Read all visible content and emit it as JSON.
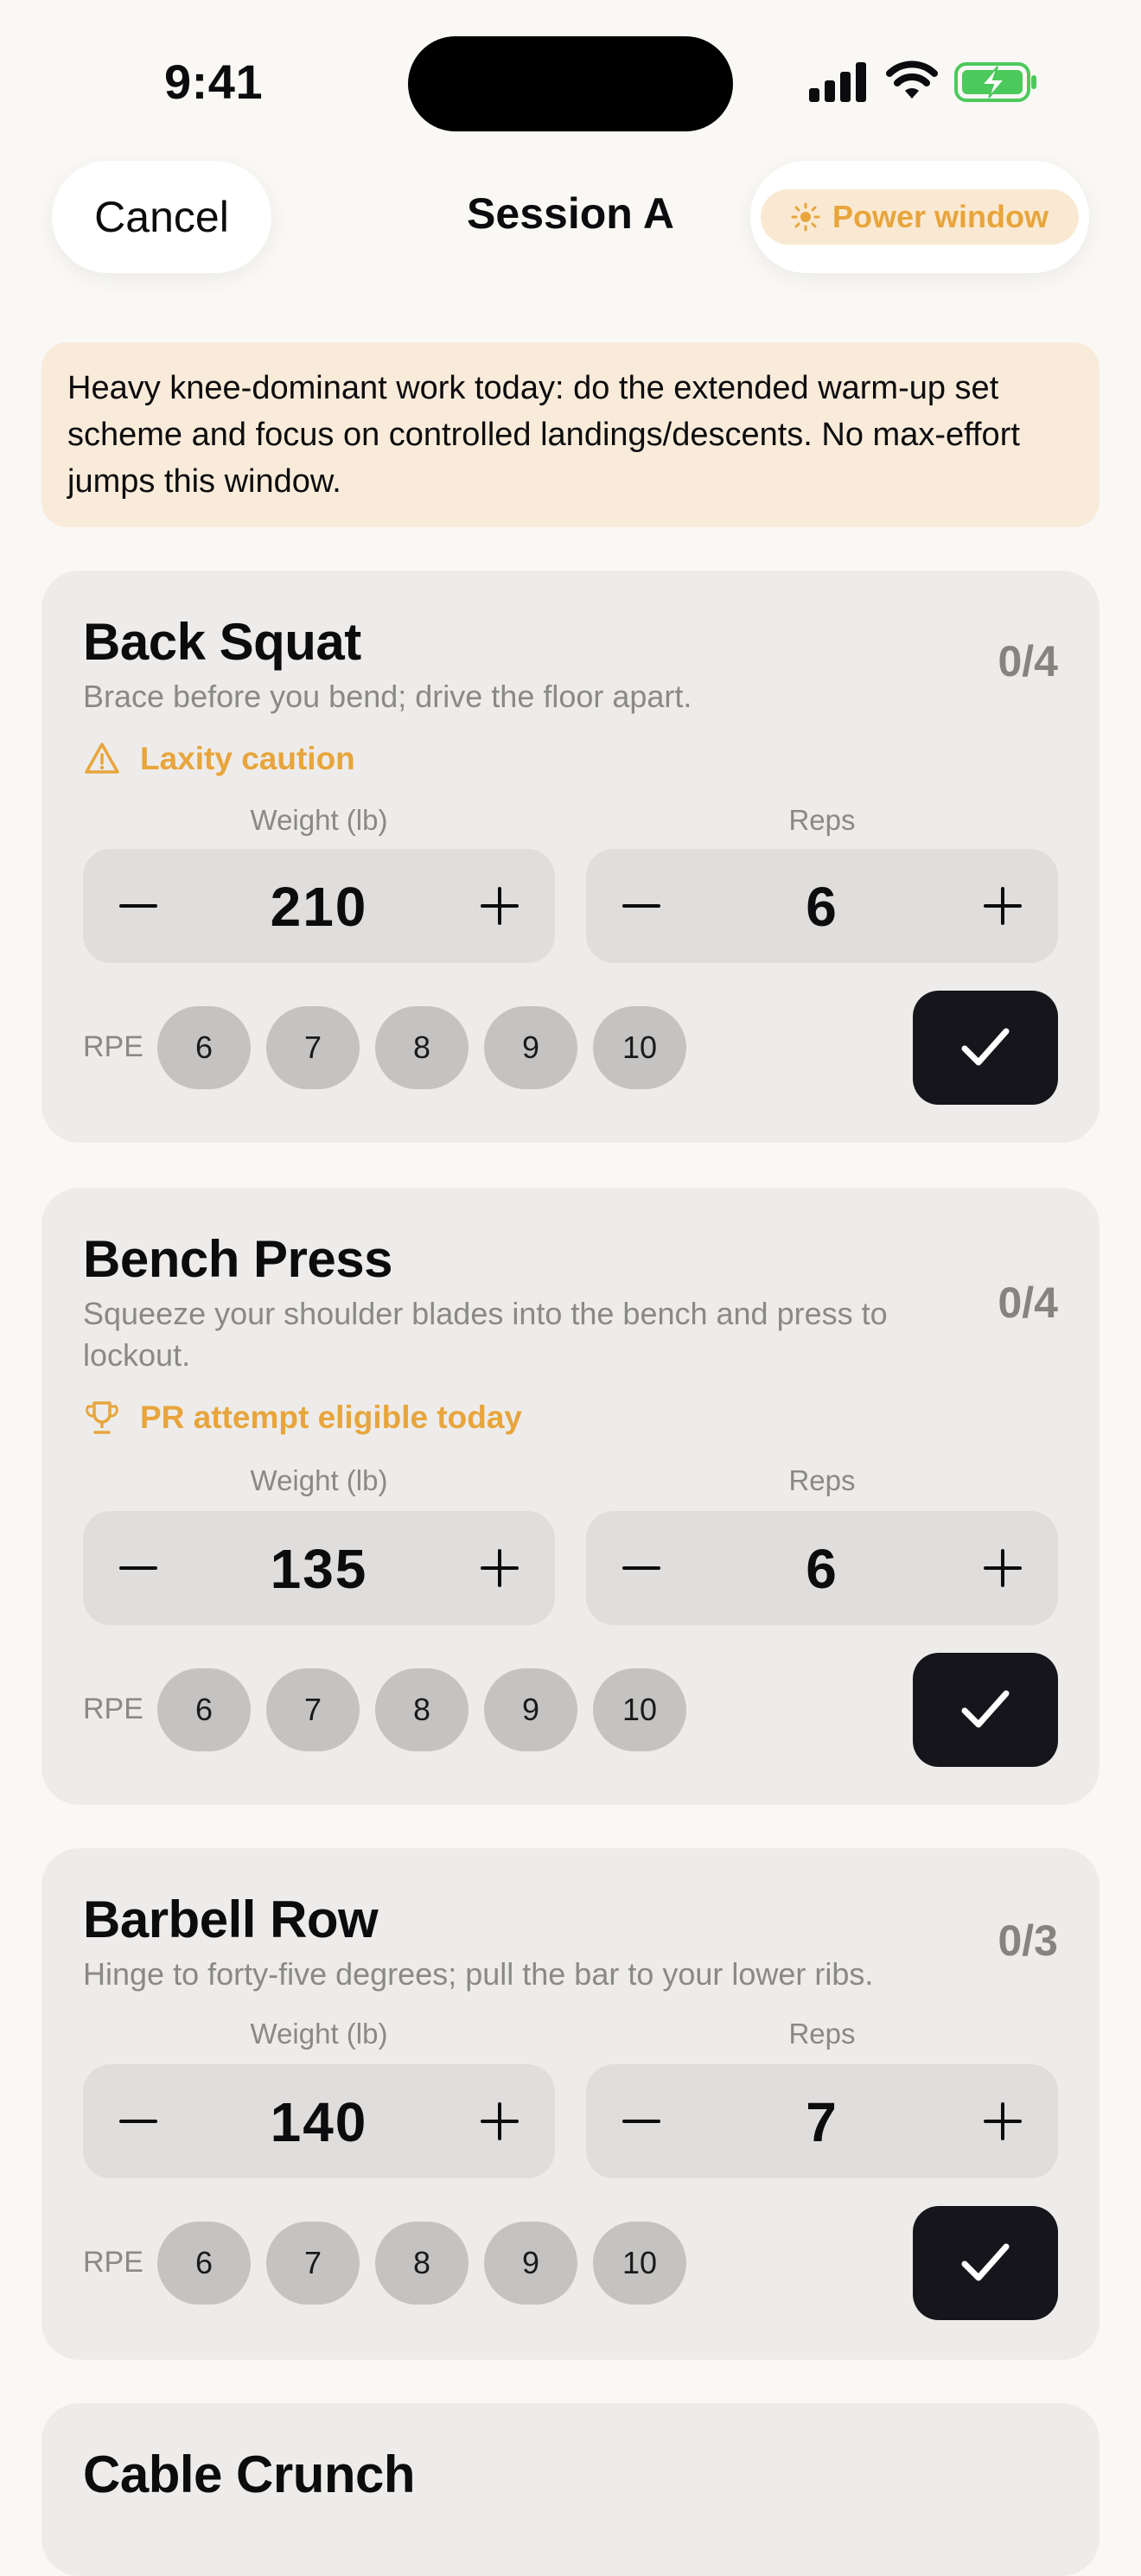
{
  "status_bar": {
    "time": "9:41"
  },
  "header": {
    "cancel_label": "Cancel",
    "title": "Session A",
    "power_label": "Power window",
    "accent_color": "#e8a53c"
  },
  "banner": {
    "text": "Heavy knee-dominant work today: do the extended warm-up set scheme and focus on controlled landings/descents. No max-effort jumps this window."
  },
  "labels": {
    "weight": "Weight (lb)",
    "reps": "Reps",
    "rpe": "RPE"
  },
  "rpe_options": [
    "6",
    "7",
    "8",
    "9",
    "10"
  ],
  "exercises": [
    {
      "name": "Back Squat",
      "cue": "Brace before you bend; drive the floor apart.",
      "progress": "0/4",
      "flag": {
        "icon": "warning-triangle-icon",
        "text": "Laxity caution"
      },
      "weight": "210",
      "reps": "6"
    },
    {
      "name": "Bench Press",
      "cue": "Squeeze your shoulder blades into the bench and press to lockout.",
      "progress": "0/4",
      "flag": {
        "icon": "trophy-icon",
        "text": "PR attempt eligible today"
      },
      "weight": "135",
      "reps": "6"
    },
    {
      "name": "Barbell Row",
      "cue": "Hinge to forty-five degrees; pull the bar to your lower ribs.",
      "progress": "0/3",
      "weight": "140",
      "reps": "7"
    },
    {
      "name": "Cable Crunch"
    }
  ]
}
